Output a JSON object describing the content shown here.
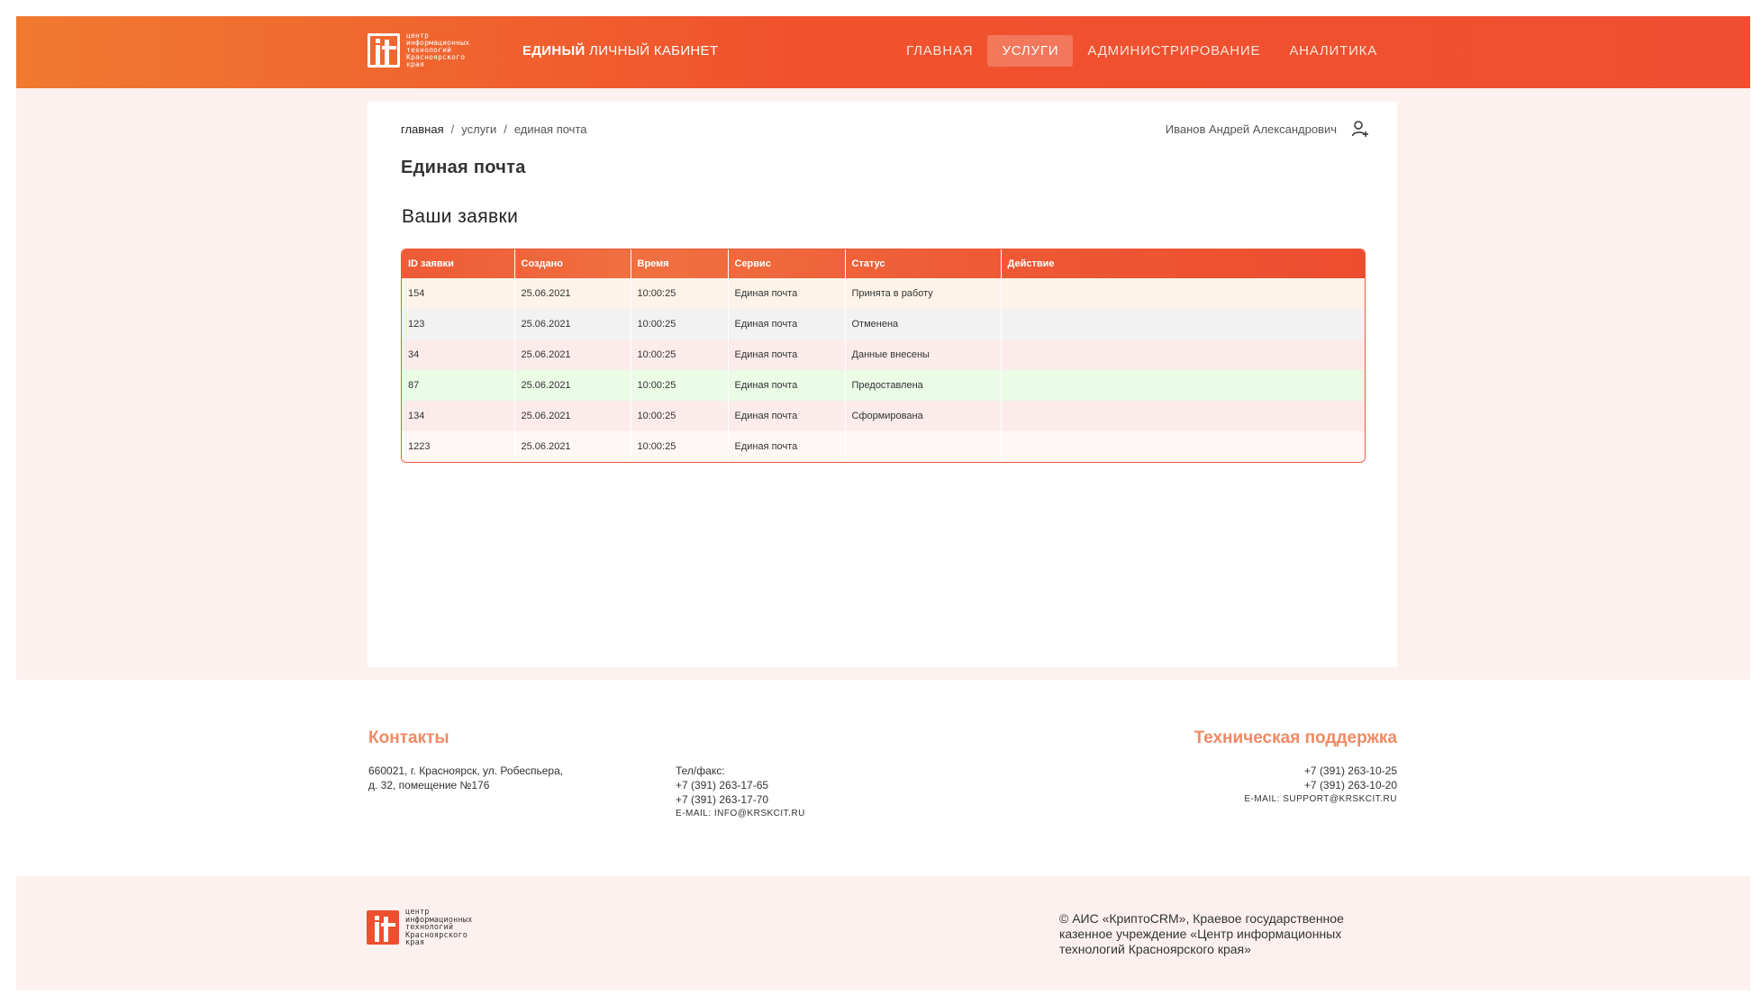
{
  "header": {
    "logo_lines": [
      "центр",
      "информационных",
      "технологий",
      "Красноярского",
      "края"
    ],
    "logo_mark": "it",
    "brand_bold": "ЕДИНЫЙ",
    "brand_rest": "ЛИЧНЫЙ КАБИНЕТ",
    "nav": [
      {
        "label": "ГЛАВНАЯ",
        "active": false
      },
      {
        "label": "УСЛУГИ",
        "active": true
      },
      {
        "label": "АДМИНИСТРИРОВАНИЕ",
        "active": false
      },
      {
        "label": "АНАЛИТИКА",
        "active": false
      }
    ]
  },
  "breadcrumb": {
    "items": [
      "главная",
      "услуги",
      "единая почта"
    ],
    "separator": "/"
  },
  "user": {
    "name": "Иванов Андрей Александрович",
    "icon": "user-add-icon"
  },
  "page_title": "Единая почта",
  "section_title": "Ваши заявки",
  "table": {
    "columns": [
      "ID заявки",
      "Создано",
      "Время",
      "Сервис",
      "Статус",
      "Действие"
    ],
    "rows": [
      {
        "id": "154",
        "created": "25.06.2021",
        "time": "10:00:25",
        "service": "Единая почта",
        "status": "Принята в работу",
        "action": "",
        "color": "#fdf3e9"
      },
      {
        "id": "123",
        "created": "25.06.2021",
        "time": "10:00:25",
        "service": "Единая почта",
        "status": "Отменена",
        "action": "",
        "color": "#f2f2f2"
      },
      {
        "id": "34",
        "created": "25.06.2021",
        "time": "10:00:25",
        "service": "Единая почта",
        "status": "Данные внесены",
        "action": "",
        "color": "#fbeceb"
      },
      {
        "id": "87",
        "created": "25.06.2021",
        "time": "10:00:25",
        "service": "Единая почта",
        "status": "Предоставлена",
        "action": "",
        "color": "#eafbe6"
      },
      {
        "id": "134",
        "created": "25.06.2021",
        "time": "10:00:25",
        "service": "Единая почта",
        "status": "Сформирована",
        "action": "",
        "color": "#fbeceb"
      },
      {
        "id": "1223",
        "created": "25.06.2021",
        "time": "10:00:25",
        "service": "Единая почта",
        "status": "",
        "action": "",
        "color": "#fff7f6"
      }
    ]
  },
  "contacts": {
    "title": "Контакты",
    "address_line1": "660021, г. Красноярск, ул. Робеспьера,",
    "address_line2": "д. 32, помещение №176",
    "phone_label": "Тел/факс:",
    "phone1": "+7 (391) 263-17-65",
    "phone2": "+7 (391) 263-17-70",
    "email": "E-MAIL: INFO@KRSKCIT.RU"
  },
  "support": {
    "title": "Техническая поддержка",
    "phone1": "+7 (391) 263-10-25",
    "phone2": "+7 (391) 263-10-20",
    "email": "E-MAIL: SUPPORT@KRSKCIT.RU"
  },
  "footer": {
    "copyright_line1": "© АИС «КриптоCRM», Краевое государственное",
    "copyright_line2": "казенное учреждение «Центр информационных",
    "copyright_line3": "технологий Красноярского края»"
  },
  "colors": {
    "accent": "#ee5230",
    "accent_light": "#f08a64",
    "page_tint": "#fdf1f0"
  }
}
